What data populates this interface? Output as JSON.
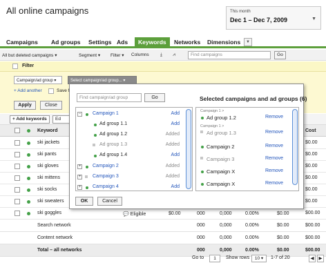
{
  "header": {
    "title": "All online campaigns",
    "date_label": "This month",
    "date_range": "Dec 1 – Dec 7, 2009"
  },
  "tabs": [
    "Campaigns",
    "Ad groups",
    "Settings",
    "Ads",
    "Keywords",
    "Networks",
    "Dimensions"
  ],
  "active_tab": "Keywords",
  "toolbar": {
    "filter_status": "All but deleted campaigns",
    "segment": "Segment",
    "filter": "Filter",
    "columns": "Columns",
    "search_placeholder": "Find campaigns",
    "go": "Go"
  },
  "filter_panel": {
    "title": "Filter",
    "campaign_select": "Campaign/ad group",
    "adgroup_select": "Select campaign/ad group...",
    "add_another": "+ Add another",
    "save_filter": "Save f",
    "apply": "Apply",
    "close": "Close"
  },
  "table": {
    "add_keywords": "+ Add keywords",
    "edit_partial": "Ed",
    "col_keyword": "Keyword",
    "col_cost": "Cost",
    "rows": [
      {
        "keyword": "ski jackets",
        "cost": "$0.00"
      },
      {
        "keyword": "ski pants",
        "cost": "$0.00"
      },
      {
        "keyword": "ski gloves",
        "cost": "$0.00"
      },
      {
        "keyword": "ski mittens",
        "cost": "$0.00"
      },
      {
        "keyword": "ski socks",
        "cost": "$0.00"
      },
      {
        "keyword": "ski sweaters",
        "cost": "$0.00"
      },
      {
        "keyword": "ski goggles",
        "status": "Eligible",
        "c1": "$0.00",
        "c2": "000",
        "c3": "0,000",
        "c4": "0.00%",
        "c5": "$0.00",
        "cost": "$00.00"
      }
    ],
    "summary": [
      {
        "label": "Search network",
        "c2": "000",
        "c3": "0,000",
        "c4": "0.00%",
        "c5": "$0.00",
        "cost": "$00.00"
      },
      {
        "label": "Content network",
        "c2": "000",
        "c3": "0,000",
        "c4": "0.00%",
        "c5": "$0.00",
        "cost": "$00.00"
      },
      {
        "label": "Total – all networks",
        "c2": "000",
        "c3": "0,000",
        "c4": "0.00%",
        "c5": "$0.00",
        "cost": "$00.00"
      }
    ]
  },
  "pager": {
    "go_to": "Go to",
    "page": "1",
    "show_rows": "Show rows",
    "rows_value": "10",
    "range": "1-7 of 20"
  },
  "popup": {
    "search_placeholder": "Find campaign/ad group",
    "go": "Go",
    "selected_title": "Selected campaigns and ad groups (6)",
    "left_items": [
      {
        "name": "Campaign 1",
        "action": "Add",
        "type": "campaign",
        "expanded": true
      },
      {
        "name": "Ad group 1.1",
        "action": "Add",
        "type": "adgroup"
      },
      {
        "name": "Ad group 1.2",
        "action": "Added",
        "type": "adgroup"
      },
      {
        "name": "Ad group 1.3",
        "action": "Added",
        "type": "adgroup-paused"
      },
      {
        "name": "Ad group 1.4",
        "action": "Add",
        "type": "adgroup"
      },
      {
        "name": "Campaign 2",
        "action": "Added",
        "type": "campaign"
      },
      {
        "name": "Campaign 3",
        "action": "Added",
        "type": "campaign-paused"
      },
      {
        "name": "Campaign 4",
        "action": "Add",
        "type": "campaign"
      }
    ],
    "right_items": [
      {
        "parent": "Campaign 1 >",
        "name": "Ad group 1.2",
        "status": "active",
        "action": "Remove"
      },
      {
        "parent": "Campaign 1 >",
        "name": "Ad group 1.3",
        "status": "paused",
        "action": "Remove"
      },
      {
        "parent": "",
        "name": "Campaign 2",
        "status": "active",
        "action": "Remove"
      },
      {
        "parent": "",
        "name": "Campaign 3",
        "status": "paused",
        "action": "Remove"
      },
      {
        "parent": "",
        "name": "Campaign X",
        "status": "active",
        "action": "Remove"
      },
      {
        "parent": "",
        "name": "Campaign X",
        "status": "active",
        "action": "Remove"
      }
    ],
    "ok": "OK",
    "cancel": "Cancel"
  }
}
